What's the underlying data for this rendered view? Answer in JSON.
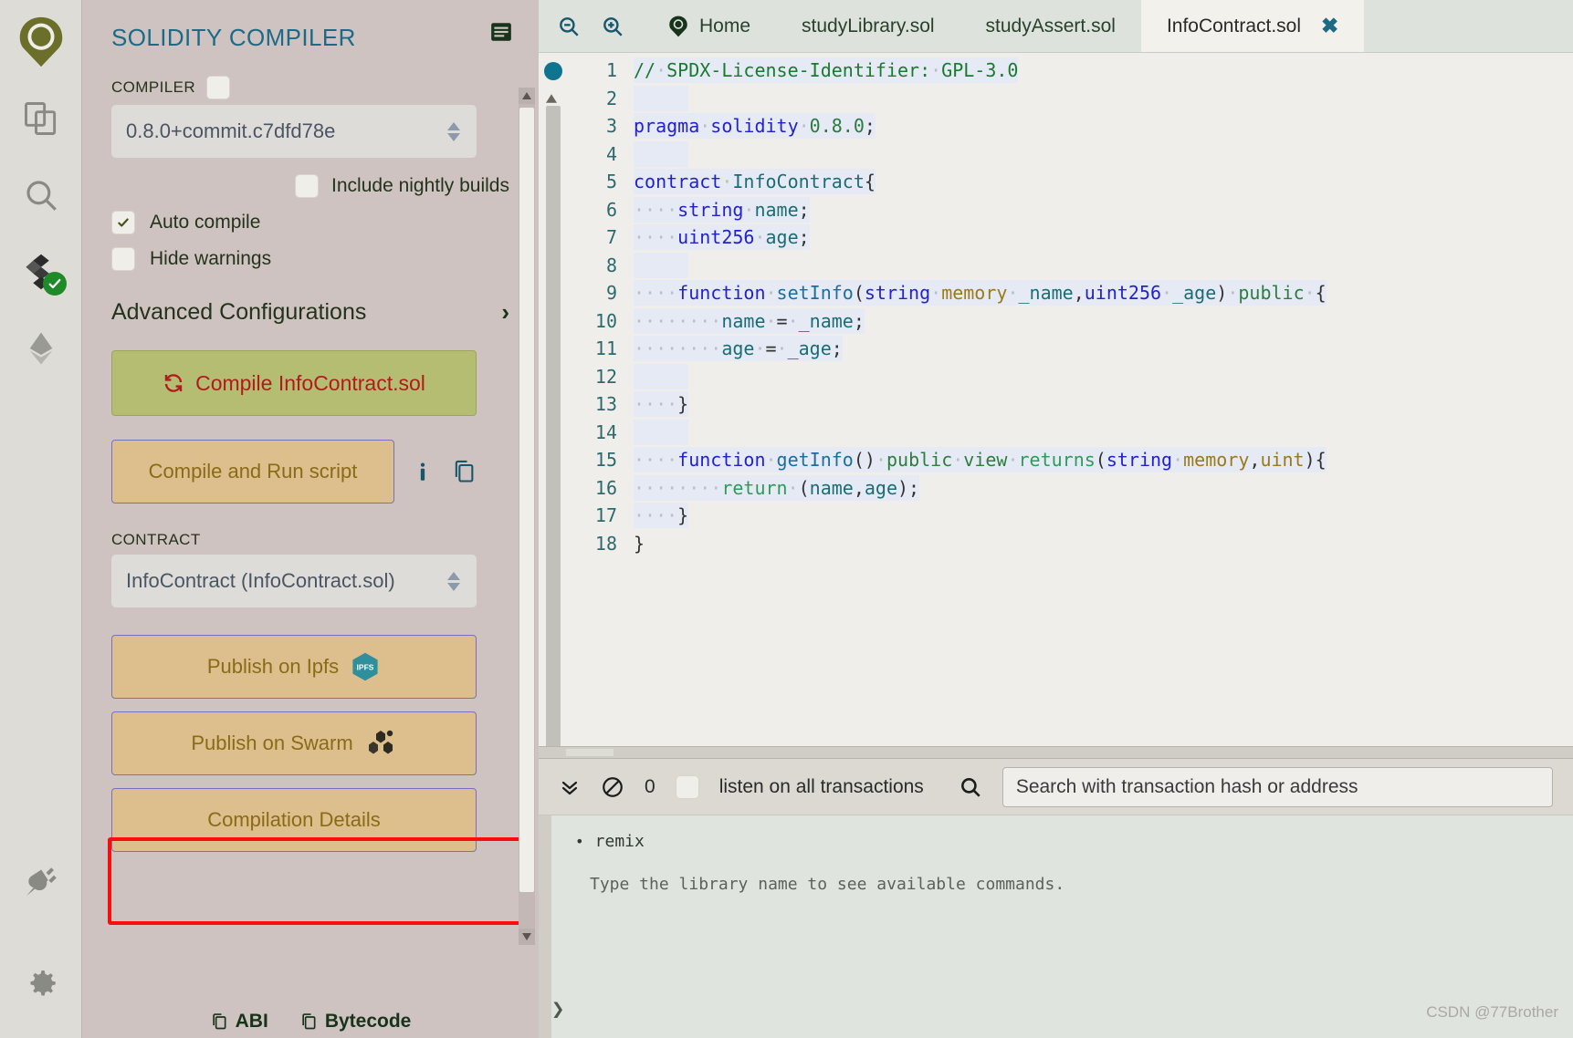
{
  "rail": {
    "items": [
      {
        "name": "home-logo-icon",
        "label": "Remix Home"
      },
      {
        "name": "file-explorer-icon",
        "label": "File explorers"
      },
      {
        "name": "search-icon",
        "label": "Search in files"
      },
      {
        "name": "solidity-compiler-icon",
        "label": "Solidity compiler",
        "badge": "check"
      },
      {
        "name": "deploy-run-icon",
        "label": "Deploy & run transactions"
      }
    ],
    "bottom_items": [
      {
        "name": "plugin-manager-icon",
        "label": "Plugin manager"
      },
      {
        "name": "settings-gear-icon",
        "label": "Settings"
      }
    ]
  },
  "panel": {
    "title": "SOLIDITY COMPILER",
    "hamburger_name": "panel-menu-icon",
    "compiler_label": "COMPILER",
    "compiler_version": "0.8.0+commit.c7dfd78e",
    "include_nightly_label": "Include nightly builds",
    "include_nightly_checked": false,
    "auto_compile_label": "Auto compile",
    "auto_compile_checked": true,
    "hide_warnings_label": "Hide warnings",
    "hide_warnings_checked": false,
    "advanced_label": "Advanced Configurations",
    "advanced_chevron": "›",
    "compile_button": "Compile InfoContract.sol",
    "compile_run_button": "Compile and Run script",
    "contract_label": "CONTRACT",
    "contract_value": "InfoContract (InfoContract.sol)",
    "publish_ipfs": "Publish on Ipfs",
    "publish_ipfs_badge": "IPFS",
    "publish_swarm": "Publish on Swarm",
    "compilation_details": "Compilation Details",
    "abi_label": "ABI",
    "bytecode_label": "Bytecode",
    "highlight_color": "#fb0d0d"
  },
  "tabbar": {
    "zoom_out_name": "zoom-out-icon",
    "zoom_in_name": "zoom-in-icon",
    "home_label": "Home",
    "tabs": [
      {
        "label": "studyLibrary.sol",
        "active": false
      },
      {
        "label": "studyAssert.sol",
        "active": false
      },
      {
        "label": "InfoContract.sol",
        "active": true
      }
    ],
    "close_glyph": "✖"
  },
  "editor": {
    "lines": [
      {
        "n": "1",
        "text": "// SPDX-License-Identifier: GPL-3.0"
      },
      {
        "n": "2",
        "text": ""
      },
      {
        "n": "3",
        "text": "pragma solidity 0.8.0;"
      },
      {
        "n": "4",
        "text": ""
      },
      {
        "n": "5",
        "text": "contract InfoContract{"
      },
      {
        "n": "6",
        "text": "    string name;"
      },
      {
        "n": "7",
        "text": "    uint256 age;"
      },
      {
        "n": "8",
        "text": ""
      },
      {
        "n": "9",
        "text": "    function setInfo(string memory _name,uint256 _age) public {"
      },
      {
        "n": "10",
        "text": "        name = _name;"
      },
      {
        "n": "11",
        "text": "        age = _age;"
      },
      {
        "n": "12",
        "text": ""
      },
      {
        "n": "13",
        "text": "    }"
      },
      {
        "n": "14",
        "text": ""
      },
      {
        "n": "15",
        "text": "    function getInfo() public view returns(string memory,uint){"
      },
      {
        "n": "16",
        "text": "        return (name,age);"
      },
      {
        "n": "17",
        "text": "    }"
      },
      {
        "n": "18",
        "text": "}"
      }
    ]
  },
  "terminal": {
    "collapse_icon": "chevrons-down-icon",
    "clear_icon": "no-entry-icon",
    "count": "0",
    "listen_label": "listen on all transactions",
    "listen_checked": false,
    "search_icon": "search-icon",
    "search_placeholder": "Search with transaction hash or address",
    "search_value": "",
    "log_bullet": "remix",
    "log_hint": "Type the library name to see available commands.",
    "prompt": "❯",
    "watermark": "CSDN @77Brother"
  }
}
